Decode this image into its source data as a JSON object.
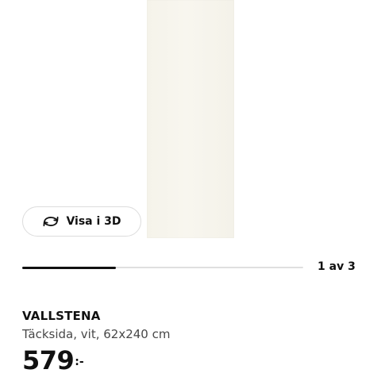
{
  "gallery": {
    "view_3d_label": "Visa i 3D",
    "view_3d_icon": "rotate-3d-icon",
    "page_counter": "1 av 3",
    "current_image": 1,
    "total_images": 3,
    "progress_fraction": 0.333
  },
  "product": {
    "name": "VALLSTENA",
    "description": "Täcksida, vit, 62x240 cm",
    "price_value": "579",
    "price_suffix": ":-"
  },
  "colors": {
    "panel_white": "#f6f4ec",
    "text_primary": "#111111",
    "text_secondary": "#484848",
    "track": "#dfdfdf"
  }
}
